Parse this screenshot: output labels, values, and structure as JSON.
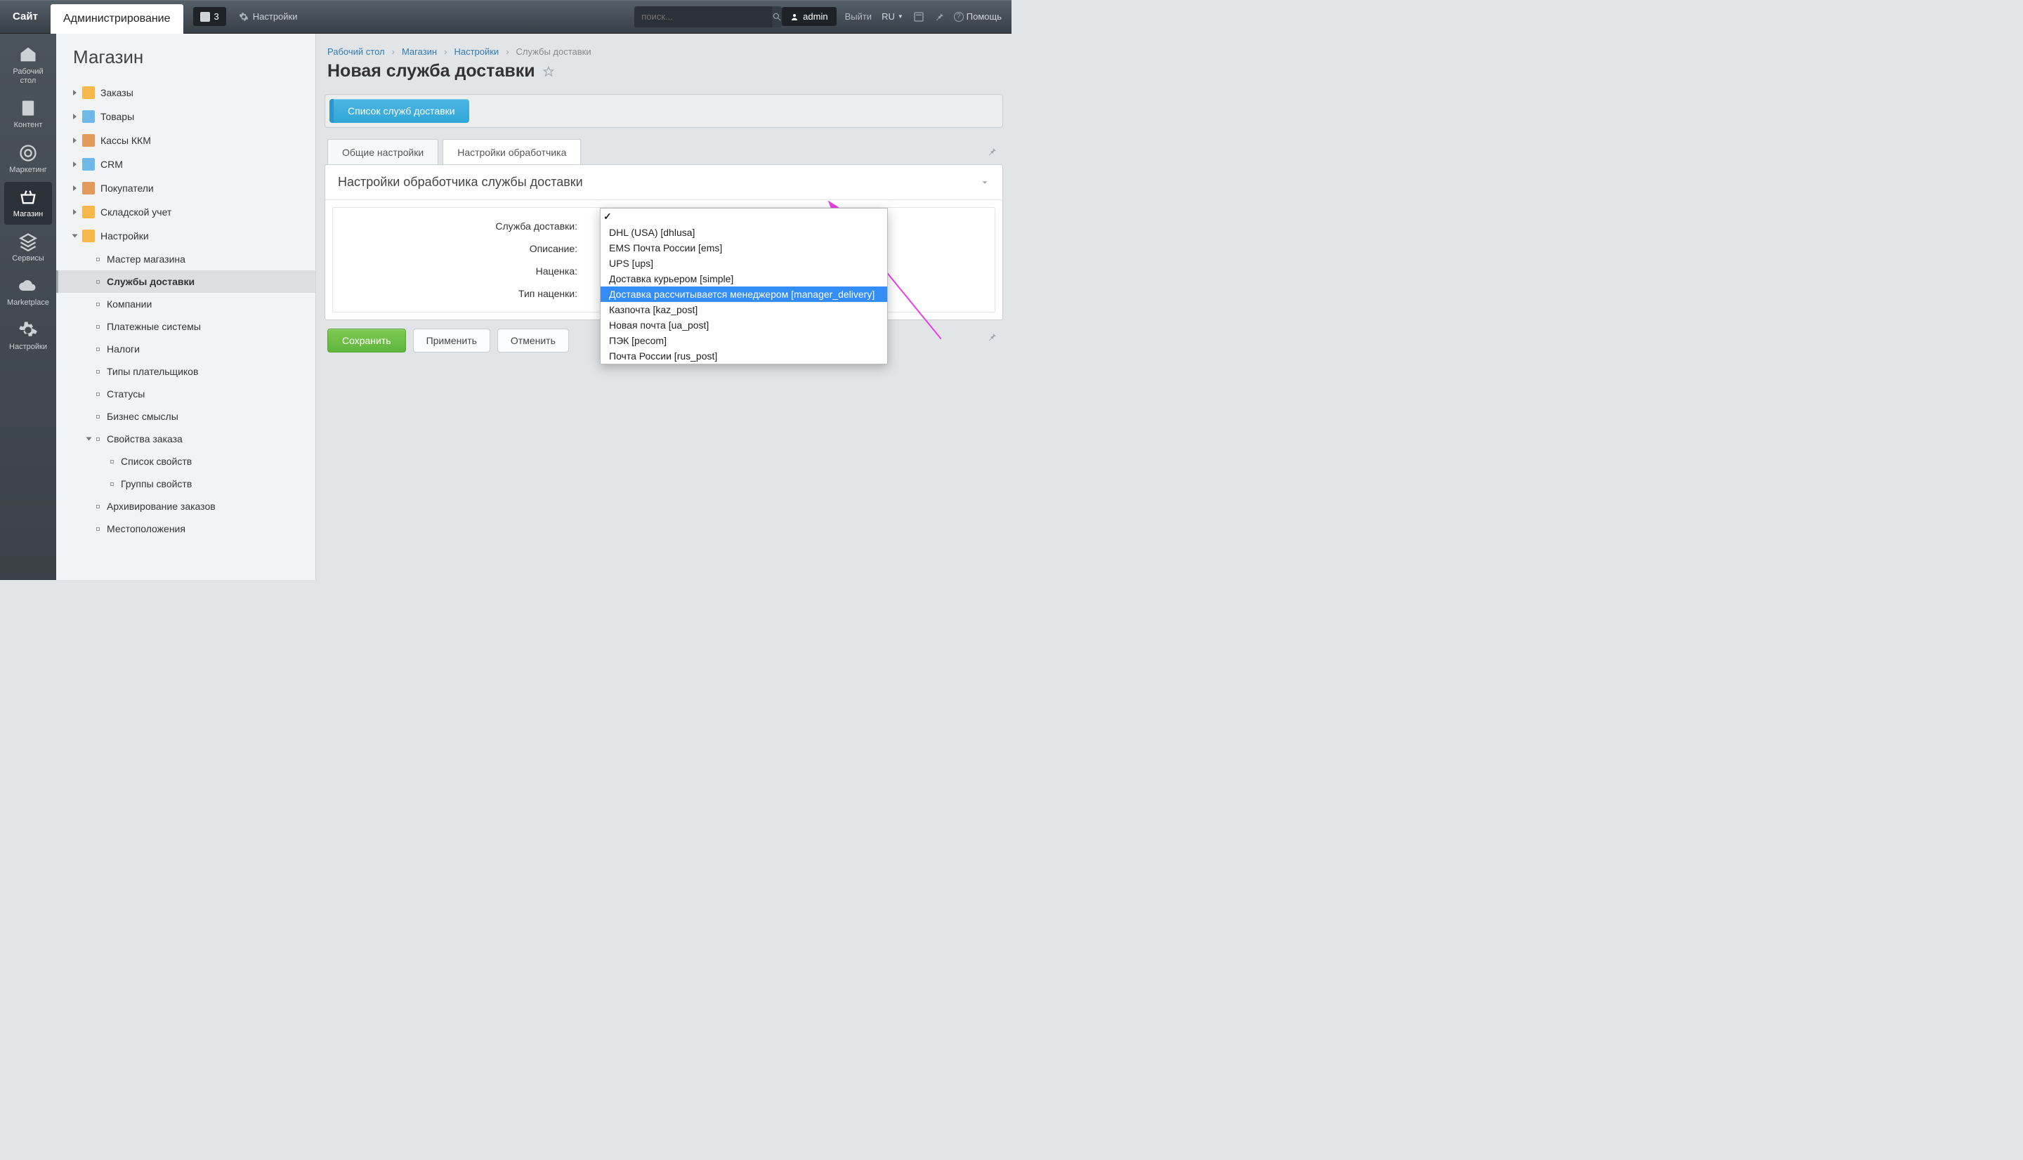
{
  "topbar": {
    "site_tab": "Сайт",
    "admin_tab": "Администрирование",
    "notif_count": "3",
    "settings": "Настройки",
    "search_placeholder": "поиск...",
    "user": "admin",
    "logout": "Выйти",
    "lang": "RU",
    "help": "Помощь"
  },
  "iconbar": {
    "items": [
      {
        "label": "Рабочий стол"
      },
      {
        "label": "Контент"
      },
      {
        "label": "Маркетинг"
      },
      {
        "label": "Магазин"
      },
      {
        "label": "Сервисы"
      },
      {
        "label": "Marketplace"
      },
      {
        "label": "Настройки"
      }
    ]
  },
  "navtree": {
    "title": "Магазин",
    "items": [
      {
        "label": "Заказы"
      },
      {
        "label": "Товары"
      },
      {
        "label": "Кассы ККМ"
      },
      {
        "label": "CRM"
      },
      {
        "label": "Покупатели"
      },
      {
        "label": "Складской учет"
      },
      {
        "label": "Настройки",
        "children": [
          {
            "label": "Мастер магазина"
          },
          {
            "label": "Службы доставки",
            "selected": true
          },
          {
            "label": "Компании"
          },
          {
            "label": "Платежные системы"
          },
          {
            "label": "Налоги"
          },
          {
            "label": "Типы плательщиков"
          },
          {
            "label": "Статусы"
          },
          {
            "label": "Бизнес смыслы"
          },
          {
            "label": "Свойства заказа",
            "children": [
              {
                "label": "Список свойств"
              },
              {
                "label": "Группы свойств"
              }
            ]
          },
          {
            "label": "Архивирование заказов"
          },
          {
            "label": "Местоположения"
          }
        ]
      }
    ]
  },
  "breadcrumbs": {
    "a": "Рабочий стол",
    "b": "Магазин",
    "c": "Настройки",
    "d": "Службы доставки"
  },
  "page": {
    "title": "Новая служба доставки",
    "list_button": "Список служб доставки",
    "tab_general": "Общие настройки",
    "tab_handler": "Настройки обработчика",
    "panel_title": "Настройки обработчика службы доставки",
    "field_service": "Служба доставки:",
    "field_description": "Описание:",
    "field_margin": "Наценка:",
    "field_margin_type": "Тип наценки:",
    "save": "Сохранить",
    "apply": "Применить",
    "cancel": "Отменить"
  },
  "dropdown": {
    "options": [
      "DHL (USA) [dhlusa]",
      "EMS Почта России [ems]",
      "UPS [ups]",
      "Доставка курьером [simple]",
      "Доставка рассчитывается менеджером [manager_delivery]",
      "Казпочта [kaz_post]",
      "Новая почта [ua_post]",
      "ПЭК [pecom]",
      "Почта России [rus_post]"
    ],
    "selected_index": 4
  }
}
